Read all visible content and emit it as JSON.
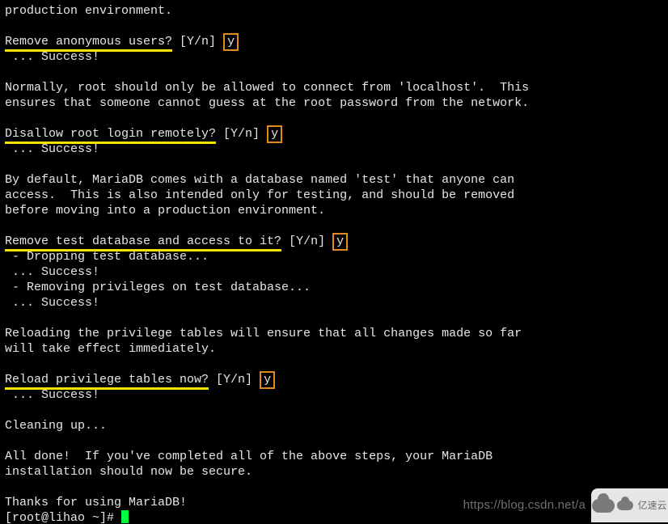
{
  "terminal": {
    "lines": {
      "l0": "production environment.",
      "q1": "Remove anonymous users?",
      "q1opts": " [Y/n] ",
      "a1": "y",
      "s1": " ... Success!",
      "p1a": "Normally, root should only be allowed to connect from 'localhost'.  This",
      "p1b": "ensures that someone cannot guess at the root password from the network.",
      "q2": "Disallow root login remotely?",
      "q2opts": " [Y/n] ",
      "a2": "y",
      "s2": " ... Success!",
      "p2a": "By default, MariaDB comes with a database named 'test' that anyone can",
      "p2b": "access.  This is also intended only for testing, and should be removed",
      "p2c": "before moving into a production environment.",
      "q3": "Remove test database and access to it?",
      "q3opts": " [Y/n] ",
      "a3": "y",
      "d1": " - Dropping test database...",
      "s3": " ... Success!",
      "d2": " - Removing privileges on test database...",
      "s4": " ... Success!",
      "p3a": "Reloading the privilege tables will ensure that all changes made so far",
      "p3b": "will take effect immediately.",
      "q4": "Reload privilege tables now?",
      "q4opts": " [Y/n] ",
      "a4": "y",
      "s5": " ... Success!",
      "clean": "Cleaning up...",
      "p4a": "All done!  If you've completed all of the above steps, your MariaDB",
      "p4b": "installation should now be secure.",
      "thanks": "Thanks for using MariaDB!",
      "prompt": "[root@lihao ~]# "
    }
  },
  "watermark": {
    "url": "https://blog.csdn.net/a",
    "brand": "亿速云"
  }
}
